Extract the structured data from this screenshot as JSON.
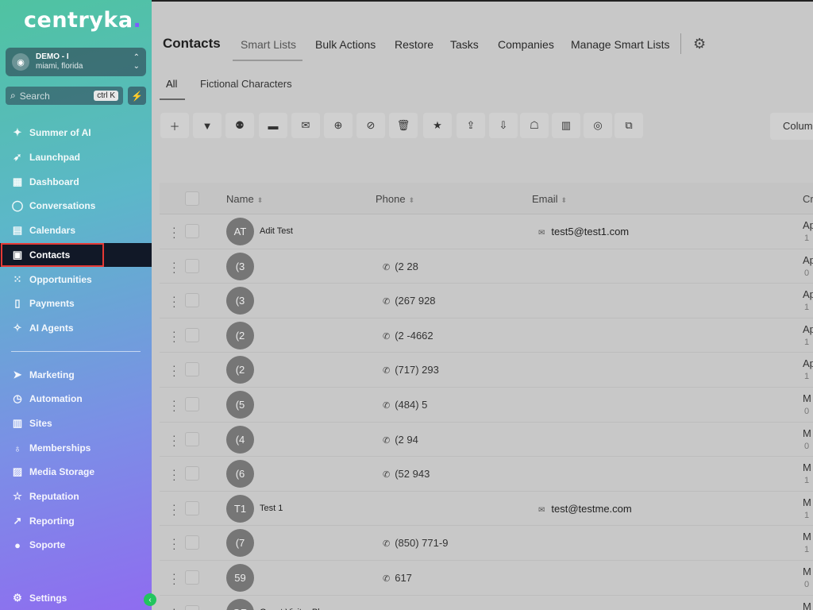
{
  "sidebar": {
    "logo": "centryka",
    "account": {
      "name": "DEMO - I",
      "location": "miami, florida"
    },
    "search": {
      "placeholder": "Search",
      "shortcut": "ctrl K"
    },
    "items": [
      {
        "label": "Summer of AI",
        "icon": "sparkle-icon"
      },
      {
        "label": "Launchpad",
        "icon": "rocket-icon"
      },
      {
        "label": "Dashboard",
        "icon": "grid-icon"
      },
      {
        "label": "Conversations",
        "icon": "chat-icon"
      },
      {
        "label": "Calendars",
        "icon": "calendar-icon"
      },
      {
        "label": "Contacts",
        "icon": "contacts-icon"
      },
      {
        "label": "Opportunities",
        "icon": "opportunities-icon"
      },
      {
        "label": "Payments",
        "icon": "payments-icon"
      },
      {
        "label": "AI Agents",
        "icon": "ai-sparkle-icon"
      },
      {
        "label": "Marketing",
        "icon": "send-icon"
      },
      {
        "label": "Automation",
        "icon": "automation-icon"
      },
      {
        "label": "Sites",
        "icon": "sites-icon"
      },
      {
        "label": "Memberships",
        "icon": "membership-icon"
      },
      {
        "label": "Media Storage",
        "icon": "image-icon"
      },
      {
        "label": "Reputation",
        "icon": "star-icon"
      },
      {
        "label": "Reporting",
        "icon": "trend-icon"
      },
      {
        "label": "Soporte",
        "icon": "help-icon"
      },
      {
        "label": "Settings",
        "icon": "gear-icon"
      }
    ]
  },
  "header": {
    "title": "Contacts",
    "tabs": [
      "Smart Lists",
      "Bulk Actions",
      "Restore",
      "Tasks",
      "Companies",
      "Manage Smart Lists"
    ]
  },
  "subtabs": [
    "All",
    "Fictional Characters"
  ],
  "toolbar": {
    "columns_label": "Colum"
  },
  "table": {
    "headers": [
      "Name",
      "Phone",
      "Email",
      "Cr"
    ],
    "rows": [
      {
        "initials": "AT",
        "name": "Adit Test",
        "phone": "",
        "email": "test5@test1.com",
        "created": "Ap",
        "created_sub": "1"
      },
      {
        "initials": "(3",
        "name": "",
        "phone": "(2 28",
        "email": "",
        "created": "Ap",
        "created_sub": "0"
      },
      {
        "initials": "(3",
        "name": "",
        "phone": "(267 928",
        "email": "",
        "created": "Ap",
        "created_sub": "1"
      },
      {
        "initials": "(2",
        "name": "",
        "phone": "(2 -4662",
        "email": "",
        "created": "Ap",
        "created_sub": "1"
      },
      {
        "initials": "(2",
        "name": "",
        "phone": "(717) 293",
        "email": "",
        "created": "Ap",
        "created_sub": "1"
      },
      {
        "initials": "(5",
        "name": "",
        "phone": "(484) 5",
        "email": "",
        "created": "M",
        "created_sub": "0"
      },
      {
        "initials": "(4",
        "name": "",
        "phone": "(2 94",
        "email": "",
        "created": "M",
        "created_sub": "0"
      },
      {
        "initials": "(6",
        "name": "",
        "phone": "(52 943",
        "email": "",
        "created": "M",
        "created_sub": "1"
      },
      {
        "initials": "T1",
        "name": "Test 1",
        "phone": "",
        "email": "test@testme.com",
        "created": "M",
        "created_sub": "1"
      },
      {
        "initials": "(7",
        "name": "",
        "phone": "(850) 771-9",
        "email": "",
        "created": "M",
        "created_sub": "1"
      },
      {
        "initials": "59",
        "name": "",
        "phone": "617",
        "email": "",
        "created": "M",
        "created_sub": "0"
      },
      {
        "initials": "GR",
        "name": "Guest Visitor Phone",
        "phone": "",
        "email": "",
        "created": "M",
        "created_sub": ""
      }
    ]
  }
}
